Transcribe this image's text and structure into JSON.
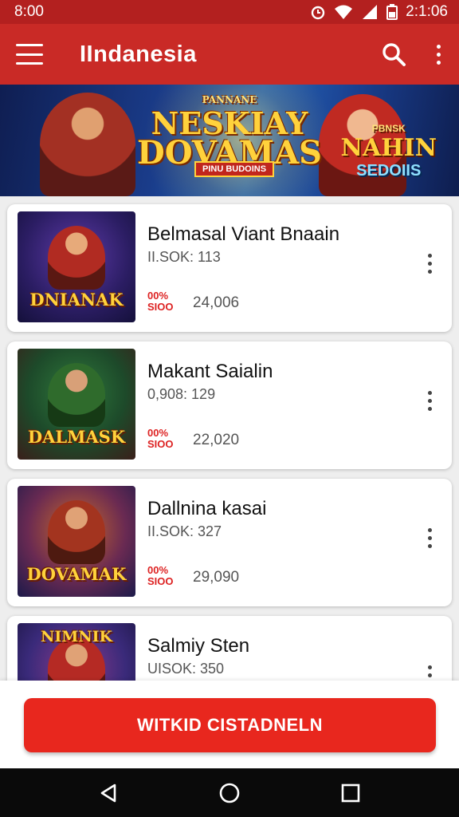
{
  "status_bar": {
    "time": "8:00",
    "right_time": "2:1:06"
  },
  "app_bar": {
    "title": "IIndanesia",
    "icons": [
      "menu-icon",
      "search-icon",
      "more-vert-icon"
    ]
  },
  "banner": {
    "line0": "PANNANE",
    "line1": "NESKIAY",
    "line2": "DOVAMAS",
    "tag": "PINU BUDOINS",
    "right_top": "PBNSK",
    "right_main": "NAHIN",
    "right_sub": "SEDOIIS"
  },
  "games": [
    {
      "title": "Belmasal Viant Bnaain",
      "meta": "II.SOK: 113",
      "badge": "00%\nSIOO",
      "count": "24,006",
      "thumb_label": "DNIANAK"
    },
    {
      "title": "Makant Saialin",
      "meta": "0,908: 129",
      "badge": "00%\nSIOO",
      "count": "22,020",
      "thumb_label": "DALMASK"
    },
    {
      "title": "Dallnina kasai",
      "meta": "II.SOK: 327",
      "badge": "00%\nSIOO",
      "count": "29,090",
      "thumb_label": "DOVAMAK"
    },
    {
      "title": "Salmiy Sten",
      "meta": "UISOK: 350",
      "badge": "",
      "count": "",
      "thumb_label": "NIMNIK"
    }
  ],
  "cta": {
    "label": "WITKID CISTADNELN"
  },
  "nav_bar": {
    "icons": [
      "back-icon",
      "home-icon",
      "recents-icon"
    ]
  },
  "colors": {
    "primary": "#c92a26",
    "status_bar": "#b3201f",
    "cta": "#e8271e",
    "badge": "#dd2222"
  }
}
